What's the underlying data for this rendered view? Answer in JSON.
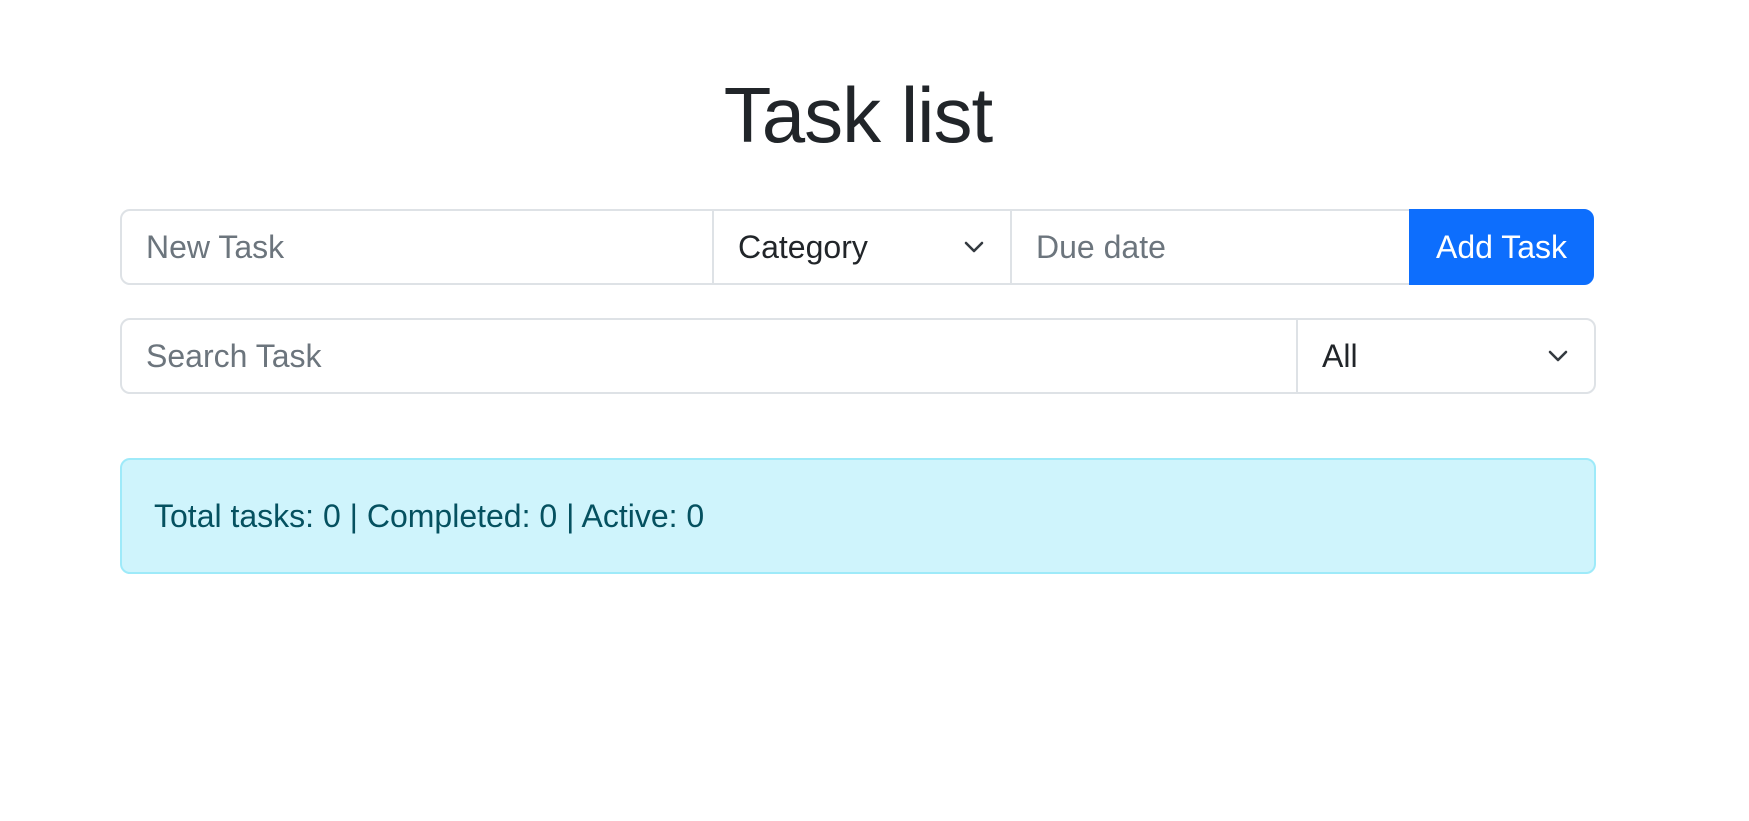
{
  "page": {
    "title": "Task list"
  },
  "add_form": {
    "new_task_placeholder": "New Task",
    "category_selected": "Category",
    "due_date_placeholder": "Due date",
    "add_button_label": "Add Task"
  },
  "filter_form": {
    "search_placeholder": "Search Task",
    "filter_selected": "All"
  },
  "summary": {
    "text": "Total tasks: 0 | Completed: 0 | Active: 0"
  },
  "colors": {
    "primary": "#0d6efd",
    "info_bg": "#cff4fc",
    "info_border": "#9eeaf9",
    "info_text": "#055160"
  },
  "icons": {
    "category_dropdown": "chevron-down-icon",
    "filter_dropdown": "chevron-down-icon"
  }
}
